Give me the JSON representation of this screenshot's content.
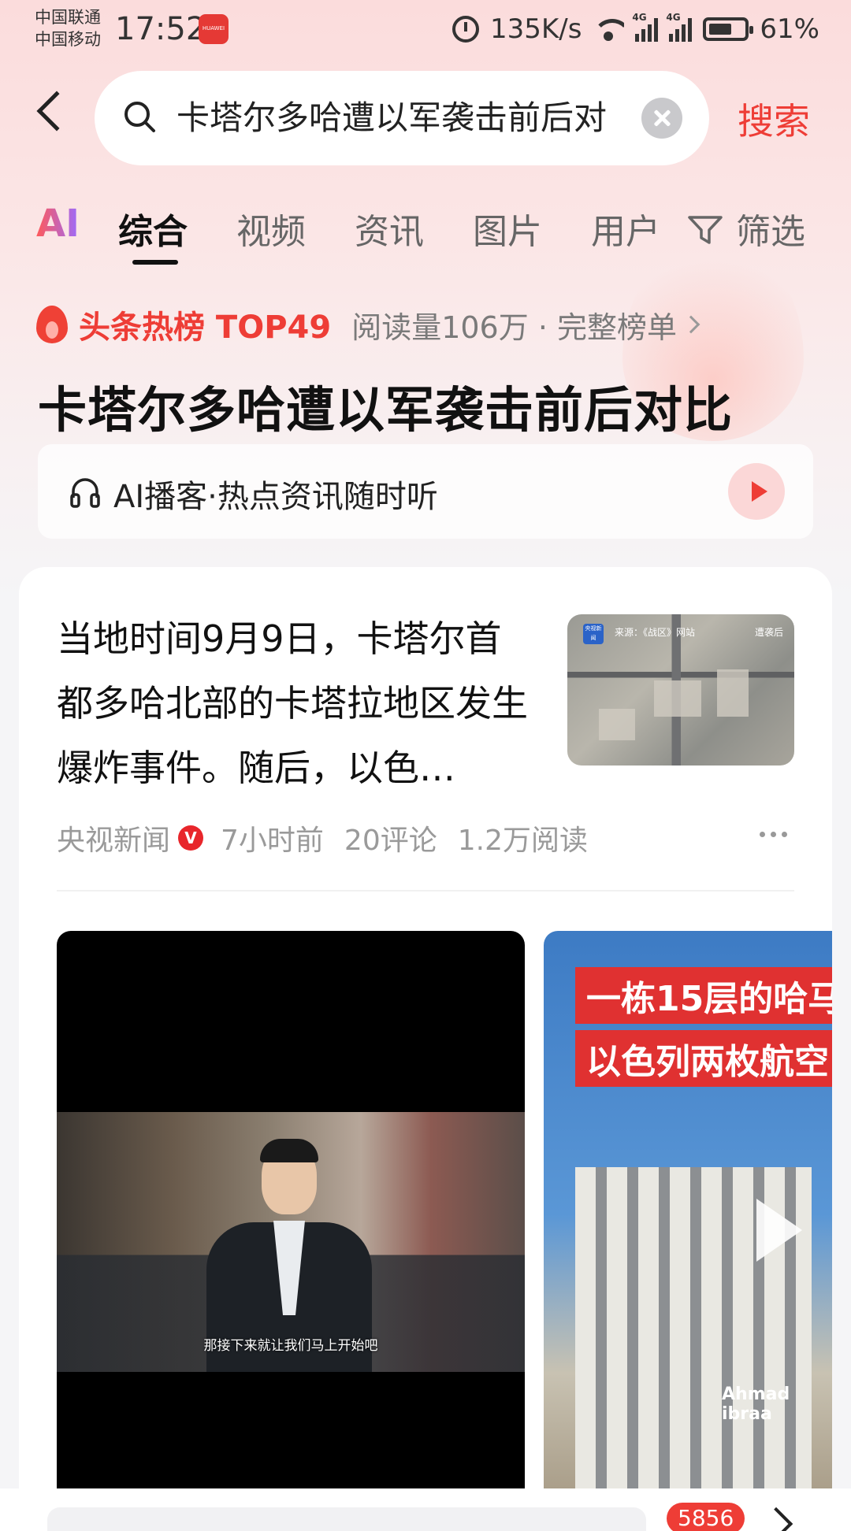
{
  "status_bar": {
    "carrier_1": "中国联通",
    "carrier_2": "中国移动",
    "time": "17:52",
    "app_badge": "HUAWEI",
    "net_speed": "135K/s",
    "network_1": "4G",
    "network_2": "4G",
    "battery": "61%"
  },
  "search": {
    "query": "卡塔尔多哈遭以军袭击前后对",
    "button_label": "搜索"
  },
  "tabs": {
    "ai": "AI",
    "items": [
      "综合",
      "视频",
      "资讯",
      "图片",
      "用户"
    ],
    "active": "综合",
    "filter_label": "筛选"
  },
  "hot": {
    "rank": "头条热榜 TOP49",
    "meta": "阅读量106万 · 完整榜单",
    "title": "卡塔尔多哈遭以军袭击前后对比"
  },
  "podcast": {
    "label": "AI播客·热点资讯随时听"
  },
  "article": {
    "text": "当地时间9月9日，卡塔尔首都多哈北部的卡塔拉地区发生爆炸事件。随后，以色…",
    "source": "央视新闻",
    "verified_mark": "V",
    "time": "7小时前",
    "comments": "20评论",
    "reads": "1.2万阅读",
    "thumb": {
      "badge": "央视新闻",
      "source_text": "来源：《战区》网站",
      "tag": "遭袭后"
    }
  },
  "videos": {
    "main_subtitle": "那接下来就让我们马上开始吧",
    "side_banner_1": "一栋15层的哈马",
    "side_banner_2": "以色列两枚航空",
    "side_credit": "Ahmad ibraa"
  },
  "bottom": {
    "count_badge": "5856"
  },
  "colors": {
    "accent": "#ee3d36",
    "verified": "#e8262b"
  }
}
